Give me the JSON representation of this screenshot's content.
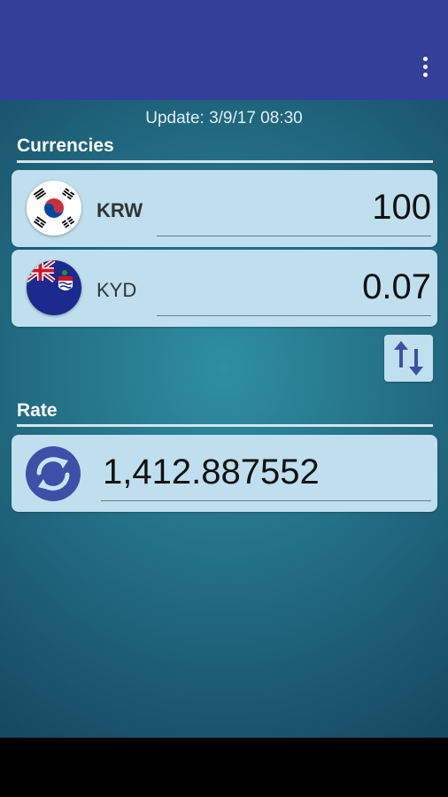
{
  "app_bar": {
    "menu_icon": "more-vert-icon",
    "color": "#333f99"
  },
  "update_text": "Update: 3/9/17 08:30",
  "currencies": {
    "title": "Currencies",
    "from": {
      "code": "KRW",
      "amount": "100",
      "flag_icon": "south-korea-flag-icon"
    },
    "to": {
      "code": "KYD",
      "amount": "0.07",
      "flag_icon": "cayman-islands-flag-icon"
    }
  },
  "swap_icon": "swap-arrows-icon",
  "rate": {
    "title": "Rate",
    "value": "1,412.887552",
    "icon": "refresh-icon"
  },
  "colors": {
    "card": "#bfdfee",
    "accent": "#3d4fa8"
  }
}
